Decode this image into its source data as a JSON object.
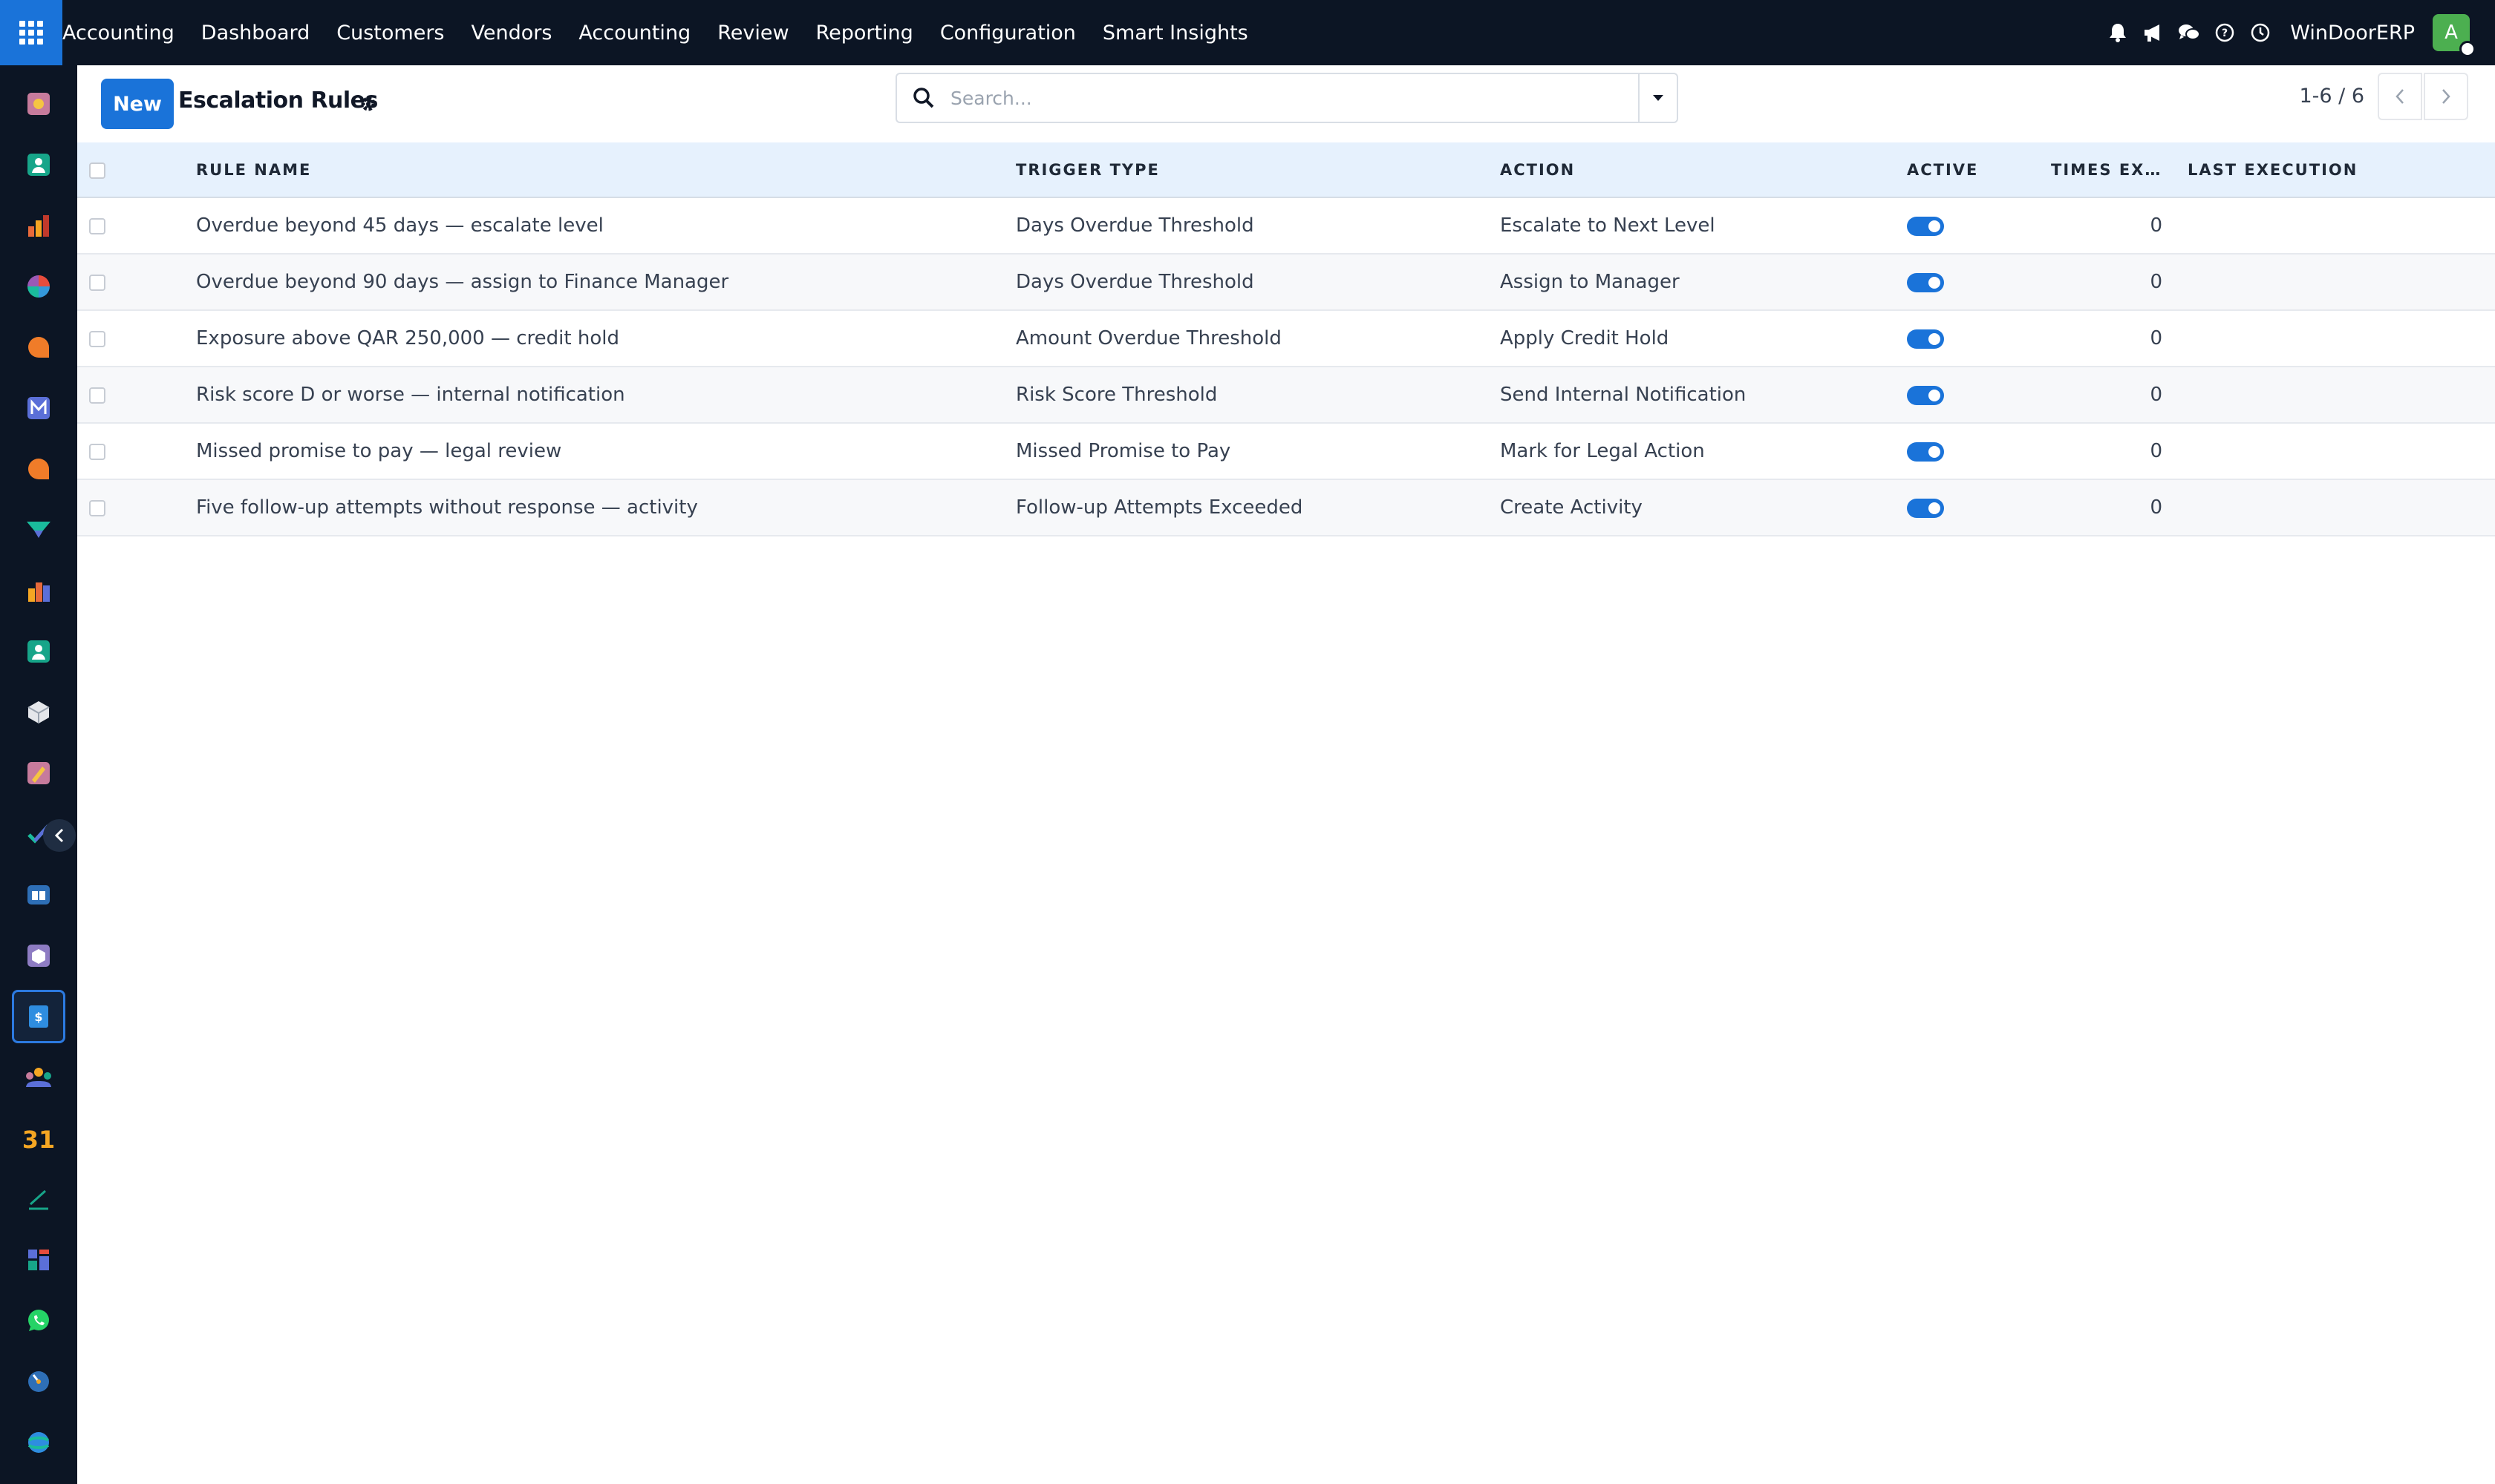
{
  "topbar": {
    "menu": [
      "Accounting",
      "Dashboard",
      "Customers",
      "Vendors",
      "Accounting",
      "Review",
      "Reporting",
      "Configuration",
      "Smart Insights"
    ],
    "company": "WinDoorERP",
    "avatar_initial": "A",
    "icons": [
      "bell-icon",
      "megaphone-icon",
      "chat-icon",
      "help-icon",
      "clock-icon"
    ]
  },
  "dock": {
    "apps": [
      "discuss-app-icon",
      "contacts-app-icon",
      "reporting-app-icon",
      "dashboard-app-icon",
      "chat-app-icon",
      "mail-app-icon",
      "live-chat-app-icon",
      "valuation-app-icon",
      "spreadsheet-app-icon",
      "employees-app-icon",
      "inventory-app-icon",
      "studio-app-icon",
      "project-app-icon",
      "knowledge-app-icon",
      "purchase-app-icon",
      "invoicing-app-icon",
      "teams-app-icon",
      "calendar-app-icon",
      "sign-app-icon",
      "dashboards-app-icon",
      "whatsapp-app-icon",
      "time-off-app-icon",
      "website-app-icon"
    ],
    "active_index": 15
  },
  "control": {
    "new_label": "New",
    "title": "Escalation Rules",
    "search_placeholder": "Search...",
    "pager": "1-6 / 6"
  },
  "table": {
    "headers": {
      "name": "RULE NAME",
      "trigger": "TRIGGER TYPE",
      "action": "ACTION",
      "active": "ACTIVE",
      "times": "TIMES EXECUTED",
      "last": "LAST EXECUTION"
    },
    "rows": [
      {
        "name": "Overdue beyond 45 days — escalate level",
        "trigger": "Days Overdue Threshold",
        "action": "Escalate to Next Level",
        "active": true,
        "times": "0",
        "last": ""
      },
      {
        "name": "Overdue beyond 90 days — assign to Finance Manager",
        "trigger": "Days Overdue Threshold",
        "action": "Assign to Manager",
        "active": true,
        "times": "0",
        "last": ""
      },
      {
        "name": "Exposure above QAR 250,000 — credit hold",
        "trigger": "Amount Overdue Threshold",
        "action": "Apply Credit Hold",
        "active": true,
        "times": "0",
        "last": ""
      },
      {
        "name": "Risk score D or worse — internal notification",
        "trigger": "Risk Score Threshold",
        "action": "Send Internal Notification",
        "active": true,
        "times": "0",
        "last": ""
      },
      {
        "name": "Missed promise to pay — legal review",
        "trigger": "Missed Promise to Pay",
        "action": "Mark for Legal Action",
        "active": true,
        "times": "0",
        "last": ""
      },
      {
        "name": "Five follow-up attempts without response — activity",
        "trigger": "Follow-up Attempts Exceeded",
        "action": "Create Activity",
        "active": true,
        "times": "0",
        "last": ""
      }
    ]
  },
  "colors": {
    "topbar_bg": "#0c1524",
    "primary": "#1a73d9",
    "header_row_bg": "#e6f1fd"
  }
}
